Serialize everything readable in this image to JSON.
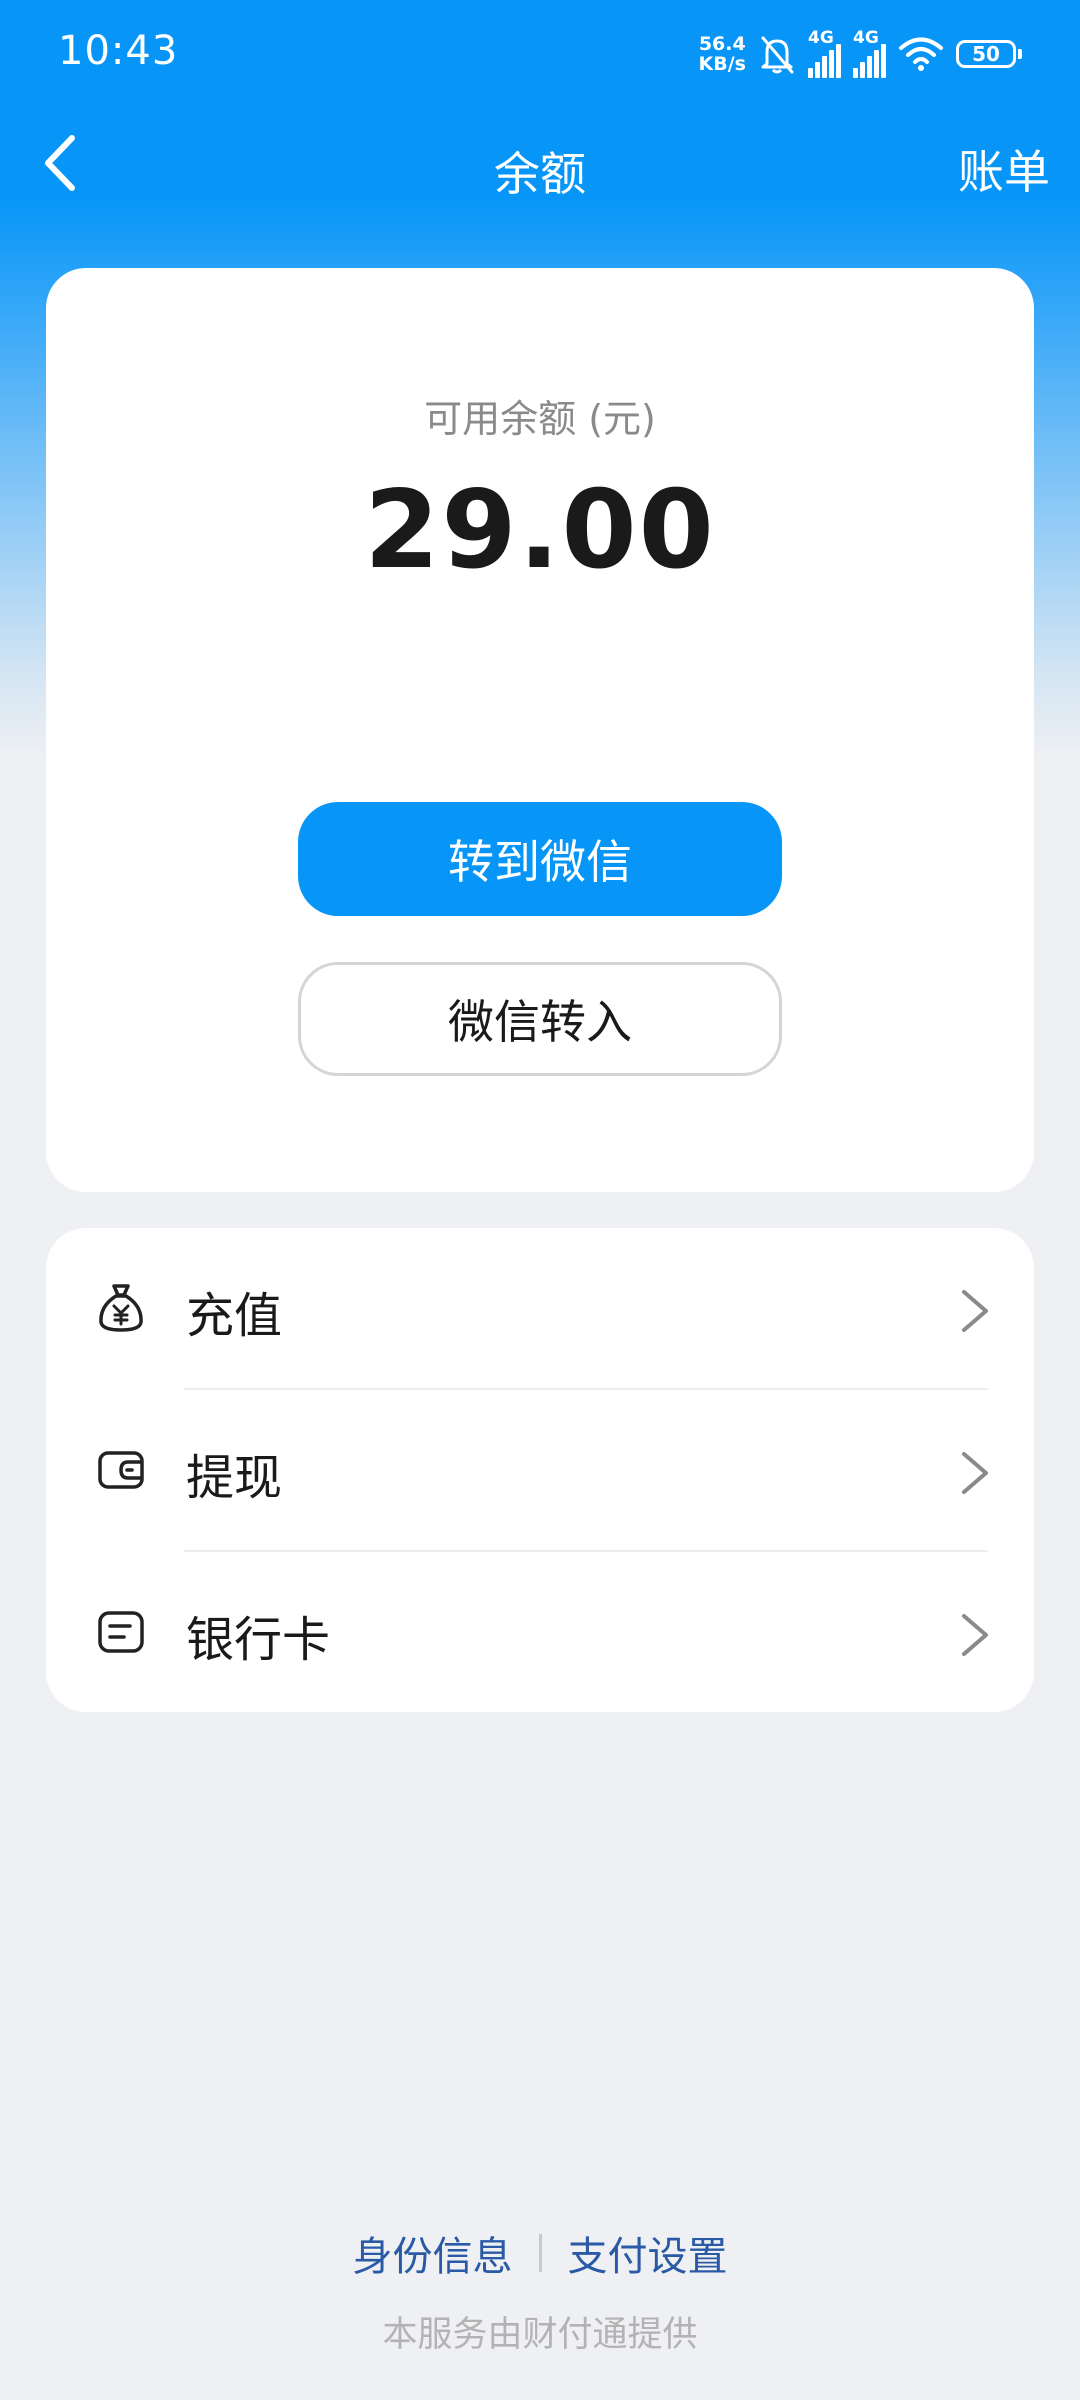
{
  "status_bar": {
    "time": "10:43",
    "net_speed_value": "56.4",
    "net_speed_unit": "KB/s",
    "signal1_label": "4G",
    "signal2_label": "4G",
    "battery": "50"
  },
  "nav": {
    "title": "余额",
    "bill": "账单"
  },
  "balance": {
    "label": "可用余额 (元)",
    "value": "29.00",
    "primary_button": "转到微信",
    "secondary_button": "微信转入"
  },
  "menu": {
    "items": [
      {
        "label": "充值",
        "icon": "money-bag-icon"
      },
      {
        "label": "提现",
        "icon": "wallet-icon"
      },
      {
        "label": "银行卡",
        "icon": "card-icon"
      }
    ]
  },
  "footer": {
    "identity_link": "身份信息",
    "payment_settings_link": "支付设置",
    "note": "本服务由财付通提供"
  },
  "colors": {
    "brand_blue": "#0796f8",
    "link_blue": "#2a5aa6",
    "background": "#eff0f3"
  }
}
